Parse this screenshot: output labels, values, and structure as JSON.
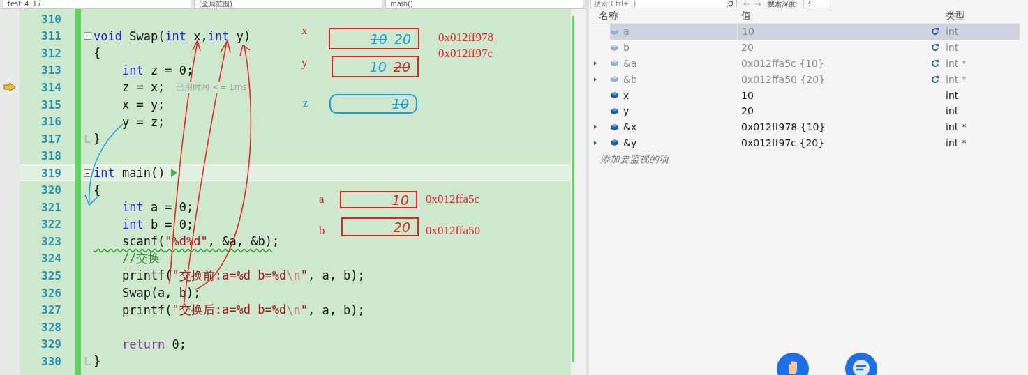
{
  "toolbar": {
    "project": "test_4_17",
    "scope": "(全局范围)",
    "function": "main()"
  },
  "editor": {
    "lines": [
      {
        "number": "310",
        "fold_start": false,
        "fold_end": false,
        "current": false,
        "highlight": false
      },
      {
        "number": "311",
        "tokens": [
          {
            "t": "void",
            "kind": "keyword"
          },
          {
            "t": " Swap(",
            "kind": "plain"
          },
          {
            "t": "int",
            "kind": "keyword"
          },
          {
            "t": " x,",
            "kind": "plain"
          },
          {
            "t": "int",
            "kind": "keyword"
          },
          {
            "t": " y)",
            "kind": "plain"
          }
        ],
        "fold_start": true,
        "fold_end": false,
        "current": false,
        "highlight": false
      },
      {
        "number": "312",
        "tokens": [
          {
            "t": "{",
            "kind": "plain"
          }
        ],
        "fold_start": false,
        "fold_end": false,
        "current": false,
        "highlight": false
      },
      {
        "number": "313",
        "tokens": [
          {
            "t": "    int",
            "kind": "keyword"
          },
          {
            "t": " z = 0;",
            "kind": "plain"
          }
        ],
        "fold_start": false,
        "fold_end": false,
        "current": false,
        "highlight": false
      },
      {
        "number": "314",
        "tokens": [
          {
            "t": "    z = x;",
            "kind": "plain"
          }
        ],
        "fold_start": false,
        "fold_end": false,
        "current": true,
        "highlight": false,
        "hint": "已用时间 <= 1ms"
      },
      {
        "number": "315",
        "tokens": [
          {
            "t": "    x = y;",
            "kind": "plain"
          }
        ],
        "fold_start": false,
        "fold_end": false,
        "current": false,
        "highlight": false
      },
      {
        "number": "316",
        "tokens": [
          {
            "t": "    y = z;",
            "kind": "plain"
          }
        ],
        "fold_start": false,
        "fold_end": false,
        "current": false,
        "highlight": false
      },
      {
        "number": "317",
        "tokens": [
          {
            "t": "}",
            "kind": "plain"
          }
        ],
        "fold_start": false,
        "fold_end": true,
        "current": false,
        "highlight": false
      },
      {
        "number": "318",
        "fold_start": false,
        "fold_end": false,
        "current": false,
        "highlight": false
      },
      {
        "number": "319",
        "tokens": [
          {
            "t": "int",
            "kind": "keyword"
          },
          {
            "t": " main()",
            "kind": "plain"
          }
        ],
        "fold_start": true,
        "fold_end": false,
        "current": false,
        "highlight": true,
        "run_marker": true
      },
      {
        "number": "320",
        "tokens": [
          {
            "t": "{",
            "kind": "plain"
          }
        ],
        "fold_start": false,
        "fold_end": false,
        "current": false,
        "highlight": false
      },
      {
        "number": "321",
        "tokens": [
          {
            "t": "    int",
            "kind": "keyword"
          },
          {
            "t": " a = 0;",
            "kind": "plain"
          }
        ],
        "fold_start": false,
        "fold_end": false,
        "current": false,
        "highlight": false
      },
      {
        "number": "322",
        "tokens": [
          {
            "t": "    int",
            "kind": "keyword"
          },
          {
            "t": " b = 0;",
            "kind": "plain"
          }
        ],
        "fold_start": false,
        "fold_end": false,
        "current": false,
        "highlight": false
      },
      {
        "number": "323",
        "tokens": [
          {
            "t": "    scanf(",
            "kind": "plain",
            "squiggle": true
          },
          {
            "t": "\"%d%d\"",
            "kind": "string",
            "squiggle": true
          },
          {
            "t": ", &a, &b)",
            "kind": "plain",
            "squiggle": true
          },
          {
            "t": ";",
            "kind": "plain"
          }
        ],
        "fold_start": false,
        "fold_end": false,
        "current": false,
        "highlight": false
      },
      {
        "number": "324",
        "tokens": [
          {
            "t": "    //交换",
            "kind": "comment"
          }
        ],
        "fold_start": false,
        "fold_end": false,
        "current": false,
        "highlight": false
      },
      {
        "number": "325",
        "tokens": [
          {
            "t": "    printf(",
            "kind": "plain"
          },
          {
            "t": "\"交换前:a=%d b=%d",
            "kind": "string"
          },
          {
            "t": "\\n",
            "kind": "escape"
          },
          {
            "t": "\"",
            "kind": "string"
          },
          {
            "t": ", a, b);",
            "kind": "plain"
          }
        ],
        "fold_start": false,
        "fold_end": false,
        "current": false,
        "highlight": false
      },
      {
        "number": "326",
        "tokens": [
          {
            "t": "    Swap(a, b);",
            "kind": "plain"
          }
        ],
        "fold_start": false,
        "fold_end": false,
        "current": false,
        "highlight": false
      },
      {
        "number": "327",
        "tokens": [
          {
            "t": "    printf(",
            "kind": "plain"
          },
          {
            "t": "\"交换后:a=%d b=%d",
            "kind": "string"
          },
          {
            "t": "\\n",
            "kind": "escape"
          },
          {
            "t": "\"",
            "kind": "string"
          },
          {
            "t": ", a, b);",
            "kind": "plain"
          }
        ],
        "fold_start": false,
        "fold_end": false,
        "current": false,
        "highlight": false
      },
      {
        "number": "328",
        "fold_start": false,
        "fold_end": false,
        "current": false,
        "highlight": false
      },
      {
        "number": "329",
        "tokens": [
          {
            "t": "    return",
            "kind": "control"
          },
          {
            "t": " 0;",
            "kind": "plain"
          }
        ],
        "fold_start": false,
        "fold_end": false,
        "current": false,
        "highlight": false
      },
      {
        "number": "330",
        "tokens": [
          {
            "t": "}",
            "kind": "plain"
          }
        ],
        "fold_start": false,
        "fold_end": true,
        "current": false,
        "highlight": false
      }
    ]
  },
  "memory_notes": [
    {
      "label": "x",
      "color": "#e02424",
      "rounded": false,
      "marks": [
        {
          "text": "10",
          "crossed": true,
          "color": "#1e9be0"
        },
        {
          "text": "20",
          "crossed": false,
          "color": "#1e9be0"
        }
      ],
      "address": "0x012ff978"
    },
    {
      "label": "y",
      "color": "#e02424",
      "rounded": false,
      "marks": [
        {
          "text": "10",
          "crossed": false,
          "color": "#1e9be0"
        },
        {
          "text": "20",
          "crossed": true,
          "color": "#e02424"
        }
      ],
      "address": "0x012ff97c"
    },
    {
      "label": "z",
      "color": "#1e9be0",
      "rounded": true,
      "marks": [
        {
          "text": "10",
          "crossed": true,
          "color": "#1e9be0"
        }
      ]
    },
    {
      "label": "a",
      "color": "#e02424",
      "rounded": false,
      "marks": [
        {
          "text": "10",
          "crossed": false,
          "color": "#e02424"
        }
      ],
      "address": "0x012ffa5c"
    },
    {
      "label": "b",
      "color": "#e02424",
      "rounded": false,
      "marks": [
        {
          "text": "20",
          "crossed": false,
          "color": "#e02424"
        }
      ],
      "address": "0x012ffa50"
    }
  ],
  "watch": {
    "search": {
      "placeholder": "搜索(Ctrl+E)"
    },
    "depth_label": "搜索深度:",
    "depth": "3",
    "columns": [
      "名称",
      "值",
      "类型"
    ],
    "rows": [
      {
        "name": "a",
        "value": "10",
        "type": "int",
        "expandable": false,
        "stale": true,
        "selected": true
      },
      {
        "name": "b",
        "value": "20",
        "type": "int",
        "expandable": false,
        "stale": true,
        "selected": false
      },
      {
        "name": "&a",
        "value": "0x012ffa5c {10}",
        "type": "int *",
        "expandable": true,
        "stale": true,
        "selected": false
      },
      {
        "name": "&b",
        "value": "0x012ffa50 {20}",
        "type": "int *",
        "expandable": true,
        "stale": true,
        "selected": false
      },
      {
        "name": "x",
        "value": "10",
        "type": "int",
        "expandable": false,
        "stale": false,
        "selected": false
      },
      {
        "name": "y",
        "value": "20",
        "type": "int",
        "expandable": false,
        "stale": false,
        "selected": false
      },
      {
        "name": "&x",
        "value": "0x012ff978 {10}",
        "type": "int *",
        "expandable": true,
        "stale": false,
        "selected": false
      },
      {
        "name": "&y",
        "value": "0x012ff97c {20}",
        "type": "int *",
        "expandable": true,
        "stale": false,
        "selected": false
      }
    ],
    "add_placeholder": "添加要监视的项"
  }
}
